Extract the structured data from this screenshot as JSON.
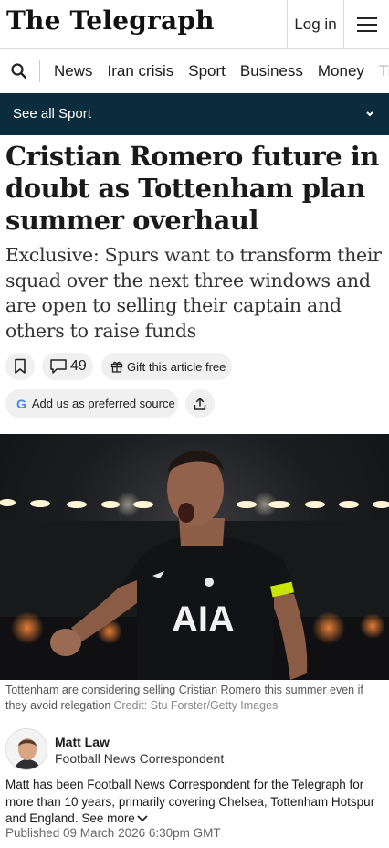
{
  "header": {
    "logo": "The Telegraph",
    "login_label": "Log in",
    "menu_icon": "hamburger-menu-icon"
  },
  "nav": {
    "search_icon": "search-icon",
    "items": [
      "News",
      "Iran crisis",
      "Sport",
      "Business",
      "Money",
      "Ti"
    ]
  },
  "section_bar": {
    "label": "See all Sport",
    "chevron_icon": "chevron-down-icon",
    "background": "#0a2c3d"
  },
  "article": {
    "headline": "Cristian Romero future in doubt as Tottenham plan summer overhaul",
    "standfirst": "Exclusive: Spurs want to transform their squad over the next three windows and are open to selling their captain and others to raise funds",
    "comment_count": "49",
    "gift_label": "Gift this article free",
    "source_label": "Add us as preferred source",
    "caption": "Tottenham are considering selling Cristian Romero this summer even if they avoid relegation",
    "credit": "Credit: Stu Forster/Getty Images",
    "photo": {
      "shirt_text": "AIA"
    }
  },
  "author": {
    "name": "Matt Law",
    "role": "Football News Correspondent",
    "bio": "Matt has been Football News Correspondent for the Telegraph for more than 10 years, primarily covering Chelsea, Tottenham Hotspur and England.",
    "see_more": "See more",
    "published": "Published 09 March 2026 6:30pm GMT"
  }
}
